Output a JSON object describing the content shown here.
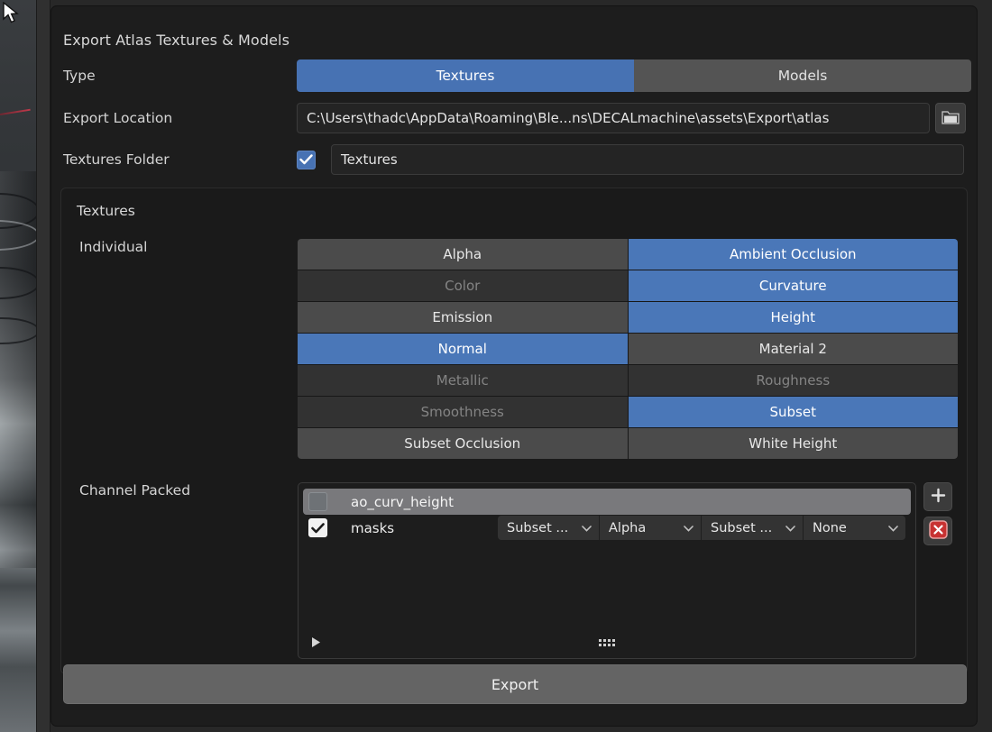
{
  "dialog": {
    "title": "Export Atlas Textures & Models"
  },
  "type_row": {
    "label": "Type",
    "options": [
      "Textures",
      "Models"
    ],
    "selected": "Textures"
  },
  "export_location": {
    "label": "Export Location",
    "value": "C:\\Users\\thadc\\AppData\\Roaming\\Ble...ns\\DECALmachine\\assets\\Export\\atlas",
    "browse_icon": "folder-icon"
  },
  "textures_folder": {
    "label": "Textures Folder",
    "checked": true,
    "value": "Textures"
  },
  "textures_panel": {
    "title": "Textures",
    "individual": {
      "label": "Individual",
      "items": [
        {
          "label": "Alpha",
          "state": "off"
        },
        {
          "label": "Ambient Occlusion",
          "state": "on"
        },
        {
          "label": "Color",
          "state": "disabled"
        },
        {
          "label": "Curvature",
          "state": "on"
        },
        {
          "label": "Emission",
          "state": "off"
        },
        {
          "label": "Height",
          "state": "on"
        },
        {
          "label": "Normal",
          "state": "on"
        },
        {
          "label": "Material 2",
          "state": "off"
        },
        {
          "label": "Metallic",
          "state": "disabled"
        },
        {
          "label": "Roughness",
          "state": "disabled"
        },
        {
          "label": "Smoothness",
          "state": "disabled"
        },
        {
          "label": "Subset",
          "state": "on"
        },
        {
          "label": "Subset Occlusion",
          "state": "off"
        },
        {
          "label": "White Height",
          "state": "off"
        }
      ]
    },
    "channel_packed": {
      "label": "Channel Packed",
      "items": [
        {
          "name": "ao_curv_height",
          "checked": false,
          "selected": true,
          "dropdowns": []
        },
        {
          "name": "masks",
          "checked": true,
          "selected": false,
          "dropdowns": [
            "Subset ...",
            "Alpha",
            "Subset ...",
            "None"
          ]
        }
      ],
      "add_button": "+",
      "add_icon": "plus-icon",
      "remove_icon": "remove-x-icon",
      "expand_icon": "triangle-right-icon",
      "grip_icon": "grip-dots-icon"
    }
  },
  "export_button": {
    "label": "Export"
  },
  "colors": {
    "accent_blue": "#4772b3",
    "panel_bg": "#1d1d1d",
    "button_gray": "#4b4b4b",
    "disabled_gray": "#323232",
    "remove_red": "#c83232"
  }
}
